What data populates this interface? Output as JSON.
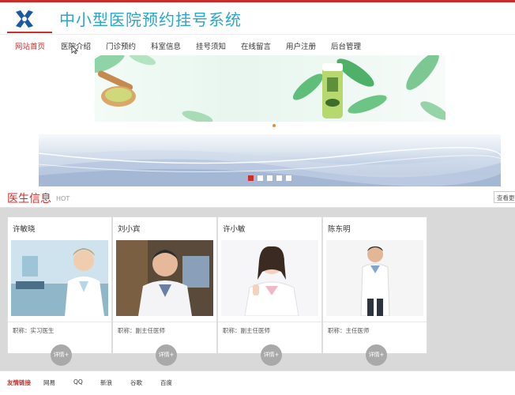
{
  "header": {
    "site_title": "中小型医院预约挂号系统",
    "logo_icon": "hospital-cross-logo-icon",
    "accent_color": "#c9302c",
    "title_color": "#2aa6c6"
  },
  "nav": {
    "items": [
      {
        "label": "网站首页",
        "active": true
      },
      {
        "label": "医院介绍",
        "active": false
      },
      {
        "label": "门诊预约",
        "active": false
      },
      {
        "label": "科室信息",
        "active": false
      },
      {
        "label": "挂号须知",
        "active": false
      },
      {
        "label": "在线留言",
        "active": false
      },
      {
        "label": "用户注册",
        "active": false
      },
      {
        "label": "后台管理",
        "active": false
      }
    ]
  },
  "carousel": {
    "slide_count": 5,
    "active_index": 0
  },
  "doctors": {
    "title": "医生信息",
    "badge": "HOT",
    "view_more": "查看更多",
    "items": [
      {
        "name": "许敏晓",
        "title": "职称：实习医生",
        "detail": "详情+"
      },
      {
        "name": "刘小宾",
        "title": "职称：副主任医师",
        "detail": "详情+"
      },
      {
        "name": "许小敏",
        "title": "职称：副主任医师",
        "detail": "详情+"
      },
      {
        "name": "陈东明",
        "title": "职称：主任医师",
        "detail": "详情+"
      }
    ]
  },
  "footer": {
    "label": "友情链接",
    "links": [
      "网易",
      "QQ",
      "新浪",
      "谷歌",
      "百度"
    ]
  }
}
